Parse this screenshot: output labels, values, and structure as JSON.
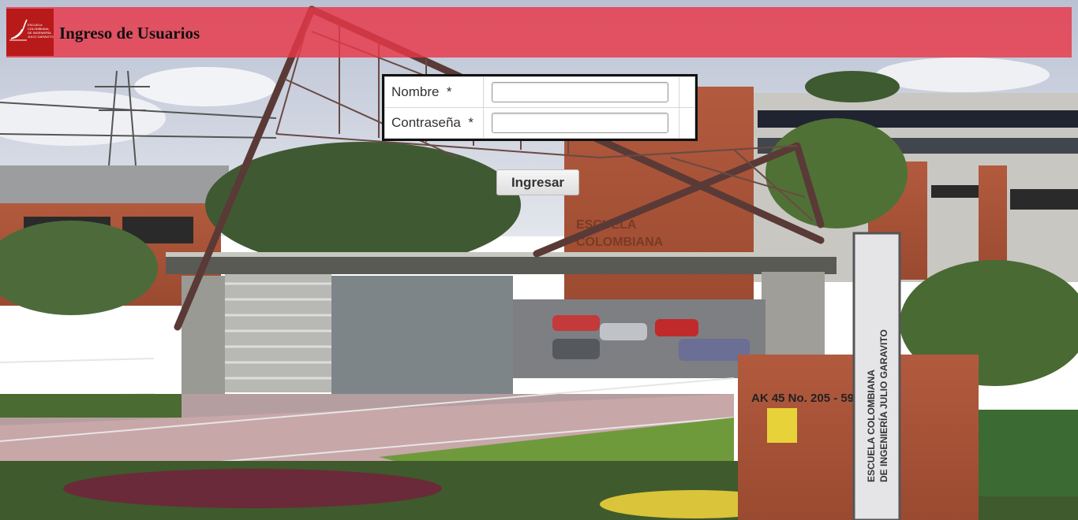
{
  "header": {
    "title": "Ingreso de Usuarios",
    "logo_text": [
      "ESCUELA",
      "COLOMBIANA",
      "DE INGENIERÍA",
      "JULIO GARAVITO"
    ],
    "background_color": "#e83748"
  },
  "form": {
    "fields": [
      {
        "label": "Nombre",
        "required_mark": "*",
        "value": ""
      },
      {
        "label": "Contraseña",
        "required_mark": "*",
        "value": ""
      }
    ],
    "submit_label": "Ingresar"
  },
  "background": {
    "building_sign": "ESCUELA COLOMBIANA DE INGENIERÍA JULIO GARAVITO",
    "address_sign": "AK 45 No. 205 - 59",
    "wall_letters": "ESCUELA COLOMBIANA DE INGENIERÍA"
  }
}
